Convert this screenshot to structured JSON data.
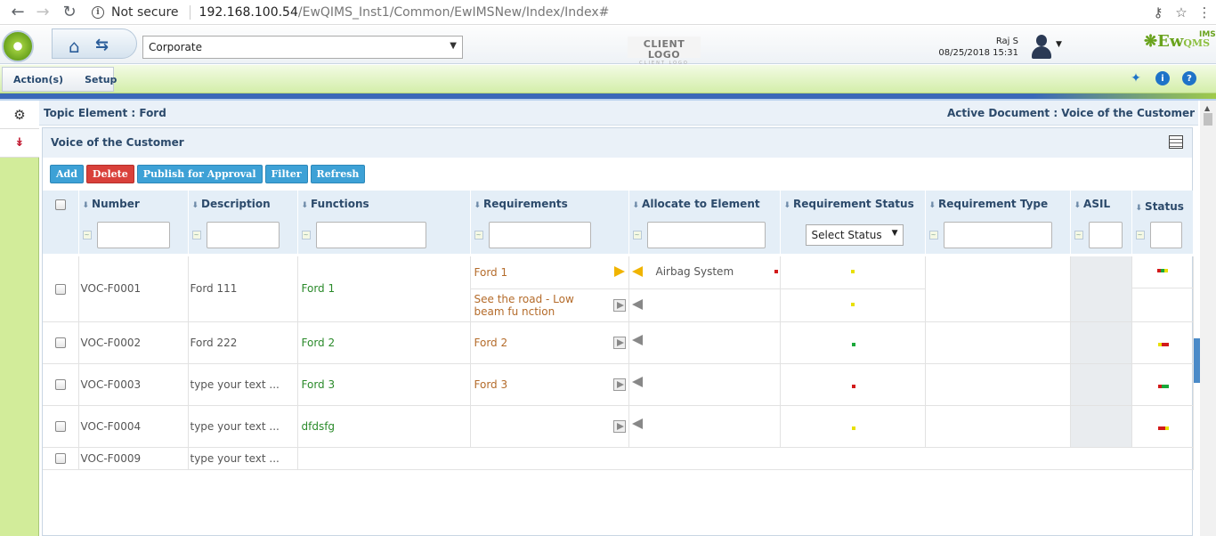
{
  "browser": {
    "secure_label": "Not secure",
    "url_host": "192.168.100.54",
    "url_path": "/EwQIMS_Inst1/Common/EwIMSNew/Index/Index#"
  },
  "header": {
    "company_select": "Corporate",
    "client_logo": "CLIENT LOGO",
    "client_logo_sub": "CLIENT LOGO",
    "user_name": "Raj S",
    "user_datetime": "08/25/2018 15:31",
    "brand": "Ew",
    "brand_sup": "IMS",
    "brand_sub": "QMS"
  },
  "menu": {
    "items": [
      "Action(s)",
      "Setup"
    ]
  },
  "topic": {
    "left": "Topic Element : Ford",
    "right": "Active Document : Voice of the Customer"
  },
  "panel": {
    "title": "Voice of the Customer"
  },
  "toolbar": {
    "add": "Add",
    "delete": "Delete",
    "publish": "Publish for Approval",
    "filter": "Filter",
    "refresh": "Refresh"
  },
  "columns": {
    "number": "Number",
    "description": "Description",
    "functions": "Functions",
    "requirements": "Requirements",
    "allocate": "Allocate to Element",
    "req_status": "Requirement Status",
    "req_type": "Requirement Type",
    "asil": "ASIL",
    "status": "Status"
  },
  "filters": {
    "status_select": "Select Status"
  },
  "rows": [
    {
      "number": "VOC-F0001",
      "description": "Ford 111",
      "function": "Ford 1",
      "requirements": [
        "Ford 1",
        "See the road - Low beam fu nction"
      ],
      "allocate": [
        "Airbag System",
        ""
      ]
    },
    {
      "number": "VOC-F0002",
      "description": "Ford 222",
      "function": "Ford 2",
      "requirements": [
        "Ford 2"
      ]
    },
    {
      "number": "VOC-F0003",
      "description": "type your text ...",
      "function": "Ford 3",
      "requirements": [
        "Ford 3"
      ]
    },
    {
      "number": "VOC-F0004",
      "description": "type your text ...",
      "function": "dfdsfg",
      "requirements": [
        ""
      ]
    },
    {
      "number": "VOC-F0009",
      "description": "type your text ..."
    }
  ],
  "colors": {
    "status_yellow": "#e8e000",
    "status_green": "#1aa83a",
    "status_red": "#d21a1a",
    "brand_green": "#6aa31e",
    "accent_blue": "#3da1d6"
  }
}
